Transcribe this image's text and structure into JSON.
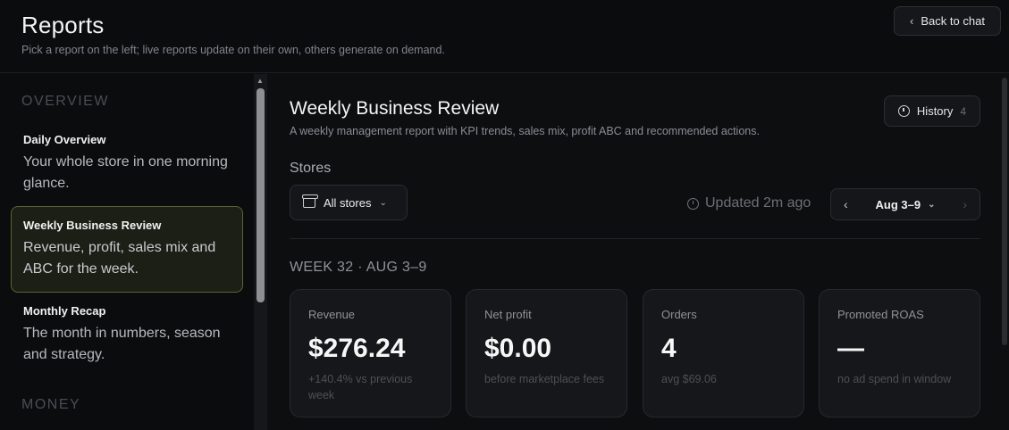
{
  "header": {
    "title": "Reports",
    "subtitle": "Pick a report on the left; live reports update on their own, others generate on demand.",
    "back_label": "Back to chat"
  },
  "sidebar": {
    "sections": [
      {
        "label": "OVERVIEW"
      },
      {
        "label": "MONEY"
      }
    ],
    "items": [
      {
        "title": "Daily Overview",
        "desc": "Your whole store in one morning glance."
      },
      {
        "title": "Weekly Business Review",
        "desc": "Revenue, profit, sales mix and ABC for the week."
      },
      {
        "title": "Monthly Recap",
        "desc": "The month in numbers, season and strategy."
      }
    ]
  },
  "report": {
    "title": "Weekly Business Review",
    "description": "A weekly management report with KPI trends, sales mix, profit ABC and recommended actions.",
    "history_label": "History",
    "history_count": "4",
    "stores_label": "Stores",
    "stores_value": "All stores",
    "updated": "Updated 2m ago",
    "date_range": "Aug 3–9",
    "week_label": "WEEK 32 · AUG 3–9"
  },
  "kpis": [
    {
      "label": "Revenue",
      "value": "$276.24",
      "sub": "+140.4% vs previous week"
    },
    {
      "label": "Net profit",
      "value": "$0.00",
      "sub": "before marketplace fees"
    },
    {
      "label": "Orders",
      "value": "4",
      "sub": "avg $69.06"
    },
    {
      "label": "Promoted ROAS",
      "value": "—",
      "sub": "no ad spend in window"
    }
  ],
  "icons": {
    "back": "chevron-left-icon",
    "history": "clock-icon",
    "store": "store-icon",
    "updated": "clock-icon"
  },
  "colors": {
    "background": "#0b0c0e",
    "active_item_border": "#5b6330",
    "active_item_bg": "#1c1f16",
    "card_bg": "#15171a"
  }
}
